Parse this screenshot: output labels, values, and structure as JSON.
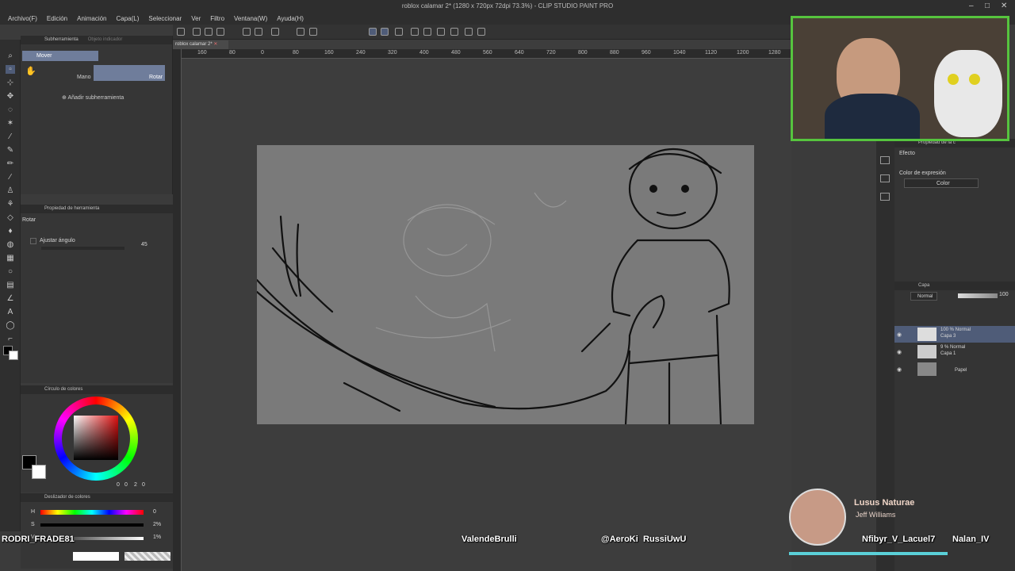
{
  "titlebar": {
    "title": "roblox calamar 2* (1280 x 720px 72dpi 73.3%) - CLIP STUDIO PAINT PRO"
  },
  "menu": [
    "Archivo(F)",
    "Edición",
    "Animación",
    "Capa(L)",
    "Seleccionar",
    "Ver",
    "Filtro",
    "Ventana(W)",
    "Ayuda(H)"
  ],
  "subtool": {
    "tab1": "Subherramienta",
    "tab2": "Objeto indicador",
    "mover": "Mover",
    "mano": "Mano",
    "rotar": "Rotar",
    "add": "Añadir subherramienta"
  },
  "toolprop": {
    "tab": "Propiedad de herramienta",
    "name": "Rotar",
    "ajustar": "Ajustar ángulo",
    "angle_value": "45"
  },
  "colorwheel": {
    "tab": "Círculo de colores",
    "v1": "0",
    "v2": "0",
    "v3": "2",
    "v4": "0"
  },
  "colorslider": {
    "tab": "Deslizador de colores",
    "h_label": "H",
    "h_value": "0",
    "s_label": "S",
    "s_value": "2%",
    "v_label": "V",
    "v_value": "1%"
  },
  "document": {
    "tab": "roblox calamar 2*"
  },
  "ruler_ticks": [
    "160",
    "80",
    "0",
    "80",
    "160",
    "240",
    "320",
    "400",
    "480",
    "560",
    "640",
    "720",
    "800",
    "880",
    "960",
    "1040",
    "1120",
    "1200",
    "1280"
  ],
  "right_panel": {
    "prop_tab": "Propiedad de la c",
    "efecto": "Efecto",
    "expresion": "Color de expresión",
    "color_select": "Color",
    "layer_tab": "Capa",
    "blend": "Normal",
    "opacity": "100",
    "layers": [
      {
        "mode": "100 % Normal",
        "name": "Capa 3"
      },
      {
        "mode": "9 % Normal",
        "name": "Capa 1"
      },
      {
        "mode": "",
        "name": "Papel"
      }
    ]
  },
  "overlay": {
    "music_title": "Lusus Naturae",
    "music_artist": "Jeff Williams",
    "chat_names": [
      "RODRI_FRADE81",
      "ValendeBrulli",
      "@AeroKi",
      "RussiUwU",
      "Nfibyr_V_Lacuel7",
      "Nalan_IV"
    ]
  },
  "colors": {
    "accent": "#6f7d9b",
    "stream_green": "#56c43e",
    "canvas": "#7a7a7a"
  }
}
